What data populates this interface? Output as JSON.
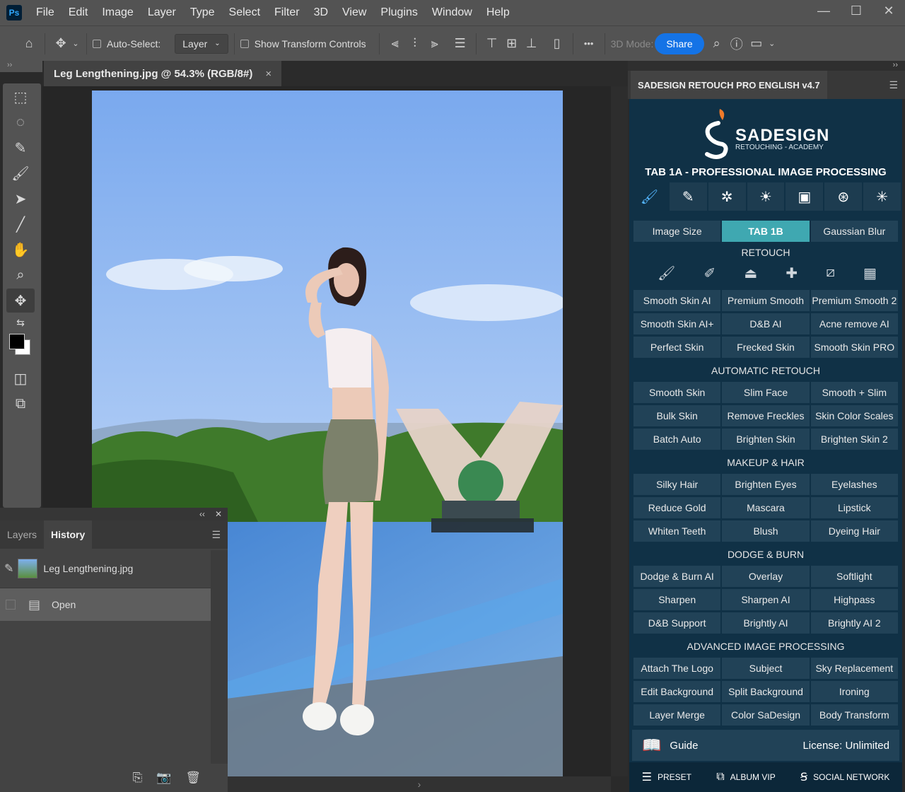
{
  "app": {
    "logo": "Ps"
  },
  "menu": [
    "File",
    "Edit",
    "Image",
    "Layer",
    "Type",
    "Select",
    "Filter",
    "3D",
    "View",
    "Plugins",
    "Window",
    "Help"
  ],
  "window_controls": {
    "minimize": "—",
    "maximize": "☐",
    "close": "✕"
  },
  "options_bar": {
    "auto_select_label": "Auto-Select:",
    "layer_select_value": "Layer",
    "show_transform_label": "Show Transform Controls",
    "mode_3d_label": "3D Mode:",
    "share_label": "Share",
    "more_label": "•••"
  },
  "document": {
    "tab_title": "Leg Lengthening.jpg @ 54.3% (RGB/8#)",
    "close_glyph": "×"
  },
  "panels_left": {
    "collapse_glyph": "‹‹",
    "close_glyph": "✕",
    "tabs": [
      "Layers",
      "History"
    ],
    "active_tab": "History",
    "history": {
      "snapshot_label": "Leg Lengthening.jpg",
      "items": [
        "Open"
      ]
    }
  },
  "sadesign": {
    "panel_title": "SADESIGN RETOUCH PRO ENGLISH v4.7",
    "logo_word": "SADESIGN",
    "logo_sub": "RETOUCHING - ACADEMY",
    "tab_heading": "TAB 1A - PROFESSIONAL IMAGE PROCESSING",
    "top_row": [
      "Image Size",
      "TAB 1B",
      "Gaussian Blur"
    ],
    "sections": {
      "retouch": "RETOUCH",
      "automatic": "AUTOMATIC RETOUCH",
      "makeup": "MAKEUP & HAIR",
      "dodge": "DODGE & BURN",
      "advanced": "ADVANCED IMAGE PROCESSING"
    },
    "retouch_rows": [
      [
        "Smooth Skin AI",
        "Premium Smooth",
        "Premium Smooth 2"
      ],
      [
        "Smooth Skin AI+",
        "D&B AI",
        "Acne remove AI"
      ],
      [
        "Perfect Skin",
        "Frecked Skin",
        "Smooth Skin PRO"
      ]
    ],
    "automatic_rows": [
      [
        "Smooth Skin",
        "Slim Face",
        "Smooth + Slim"
      ],
      [
        "Bulk Skin",
        "Remove Freckles",
        "Skin Color Scales"
      ],
      [
        "Batch Auto",
        "Brighten Skin",
        "Brighten Skin 2"
      ]
    ],
    "makeup_rows": [
      [
        "Silky Hair",
        "Brighten Eyes",
        "Eyelashes"
      ],
      [
        "Reduce Gold",
        "Mascara",
        "Lipstick"
      ],
      [
        "Whiten Teeth",
        "Blush",
        "Dyeing Hair"
      ]
    ],
    "dodge_rows": [
      [
        "Dodge & Burn AI",
        "Overlay",
        "Softlight"
      ],
      [
        "Sharpen",
        "Sharpen AI",
        "Highpass"
      ],
      [
        "D&B Support",
        "Brightly AI",
        "Brightly AI 2"
      ]
    ],
    "advanced_rows": [
      [
        "Attach The Logo",
        "Subject",
        "Sky Replacement"
      ],
      [
        "Edit Background",
        "Split Background",
        "Ironing"
      ],
      [
        "Layer Merge",
        "Color SaDesign",
        "Body Transform"
      ]
    ],
    "guide_label": "Guide",
    "license_label": "License: Unlimited",
    "bottom": [
      "PRESET",
      "ALBUM VIP",
      "SOCIAL NETWORK"
    ]
  },
  "colors": {
    "ui_dark": "#535353",
    "panel_bg": "#103146",
    "button_bg": "#214257",
    "accent": "#3fa8b1",
    "share": "#1473e6"
  }
}
